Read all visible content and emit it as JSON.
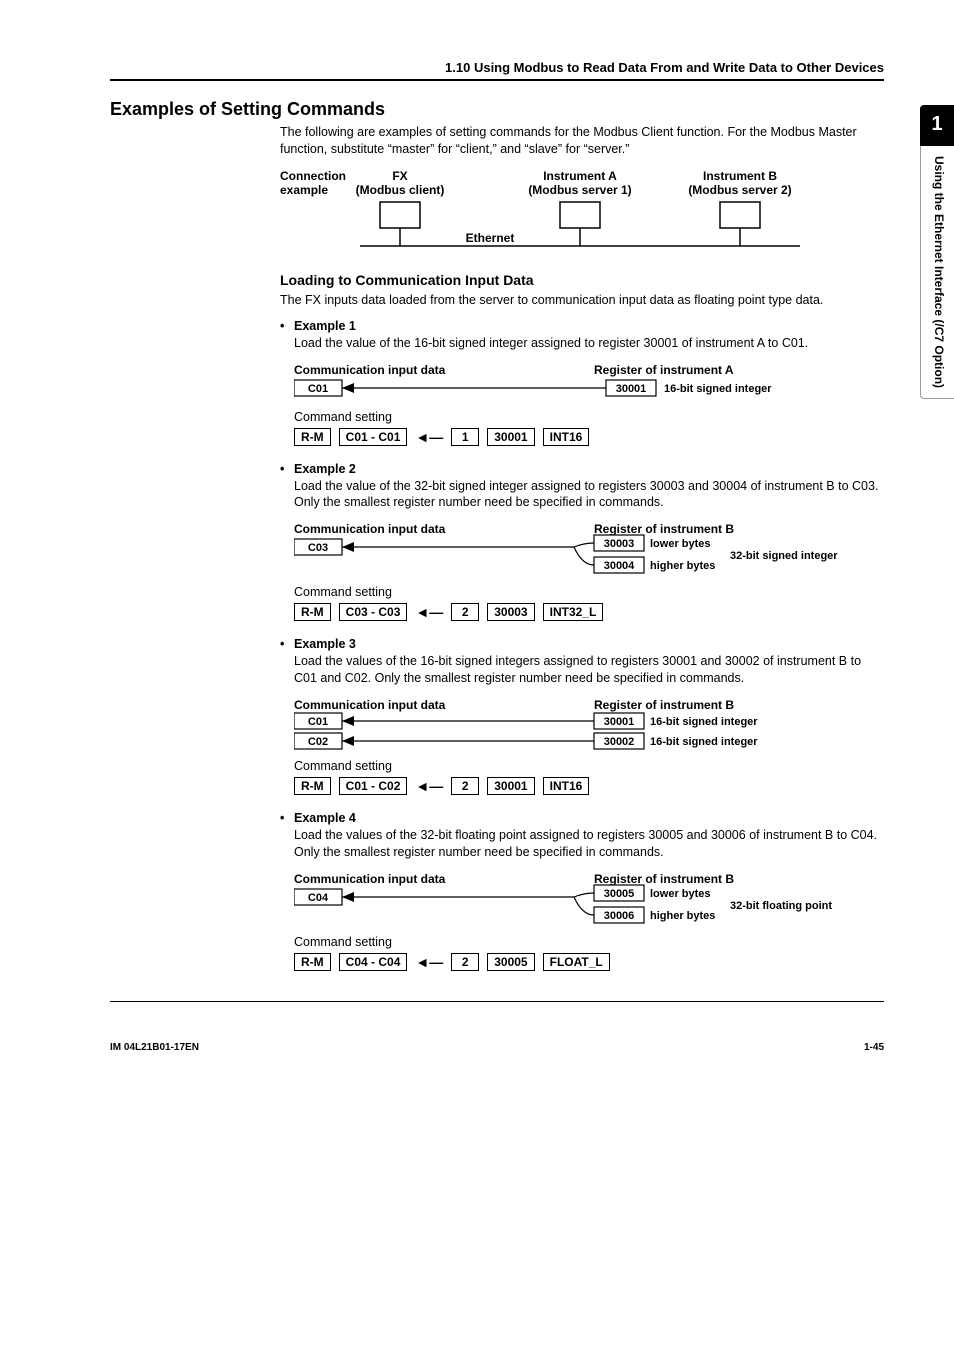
{
  "side_tab": {
    "num": "1",
    "text": "Using the Ethernet Interface (/C7 Option)"
  },
  "header": "1.10  Using Modbus to Read Data From and Write Data to Other Devices",
  "title": "Examples of Setting Commands",
  "intro": "The following are examples of setting commands for the Modbus Client function. For the Modbus Master function, substitute “master” for “client,” and “slave” for “server.”",
  "conn": {
    "col1a": "Connection",
    "col1b": "example",
    "col2a": "FX",
    "col2b": "(Modbus client)",
    "col3a": "Instrument A",
    "col3b": "(Modbus server 1)",
    "col4a": "Instrument B",
    "col4b": "(Modbus server 2)",
    "eth": "Ethernet"
  },
  "loading_heading": "Loading to Communication Input Data",
  "loading_text": "The FX inputs data loaded from the server to communication input data as floating point type data.",
  "ex1": {
    "label": "Example 1",
    "text": "Load the value of the 16-bit signed integer assigned to register 30001 of instrument A to C01.",
    "ci_label": "Communication input data",
    "ci_box": "C01",
    "reg_label": "Register of instrument A",
    "reg_box": "30001",
    "reg_type": "16-bit signed integer",
    "cmd_label": "Command setting",
    "cmd": [
      "R-M",
      "C01 - C01",
      "1",
      "30001",
      "INT16"
    ]
  },
  "ex2": {
    "label": "Example 2",
    "text": "Load the value of the 32-bit signed integer assigned to registers 30003 and 30004 of instrument B to C03. Only the smallest register number need be specified in commands.",
    "ci_label": "Communication input data",
    "ci_box": "C03",
    "reg_label": "Register of instrument B",
    "reg_box1": "30003",
    "reg_type1": "lower bytes",
    "reg_box2": "30004",
    "reg_type2": "higher bytes",
    "reg_side": "32-bit signed integer",
    "cmd_label": "Command setting",
    "cmd": [
      "R-M",
      "C03 - C03",
      "2",
      "30003",
      "INT32_L"
    ]
  },
  "ex3": {
    "label": "Example 3",
    "text": "Load the values of the 16-bit signed integers assigned to registers 30001 and 30002 of instrument B to C01 and C02. Only the smallest register number need be specified in commands.",
    "ci_label": "Communication input data",
    "ci_box1": "C01",
    "ci_box2": "C02",
    "reg_label": "Register of instrument B",
    "reg_box1": "30001",
    "reg_type1": "16-bit signed integer",
    "reg_box2": "30002",
    "reg_type2": "16-bit signed integer",
    "cmd_label": "Command setting",
    "cmd": [
      "R-M",
      "C01 - C02",
      "2",
      "30001",
      "INT16"
    ]
  },
  "ex4": {
    "label": "Example 4",
    "text": "Load the values of the 32-bit floating point assigned to registers 30005 and 30006 of instrument B to C04. Only the smallest register number need be specified in commands.",
    "ci_label": "Communication input data",
    "ci_box": "C04",
    "reg_label": "Register of instrument B",
    "reg_box1": "30005",
    "reg_type1": "lower bytes",
    "reg_box2": "30006",
    "reg_type2": "higher bytes",
    "reg_side": "32-bit floating point",
    "cmd_label": "Command setting",
    "cmd": [
      "R-M",
      "C04 - C04",
      "2",
      "30005",
      "FLOAT_L"
    ]
  },
  "footer_left": "IM 04L21B01-17EN",
  "footer_right": "1-45"
}
